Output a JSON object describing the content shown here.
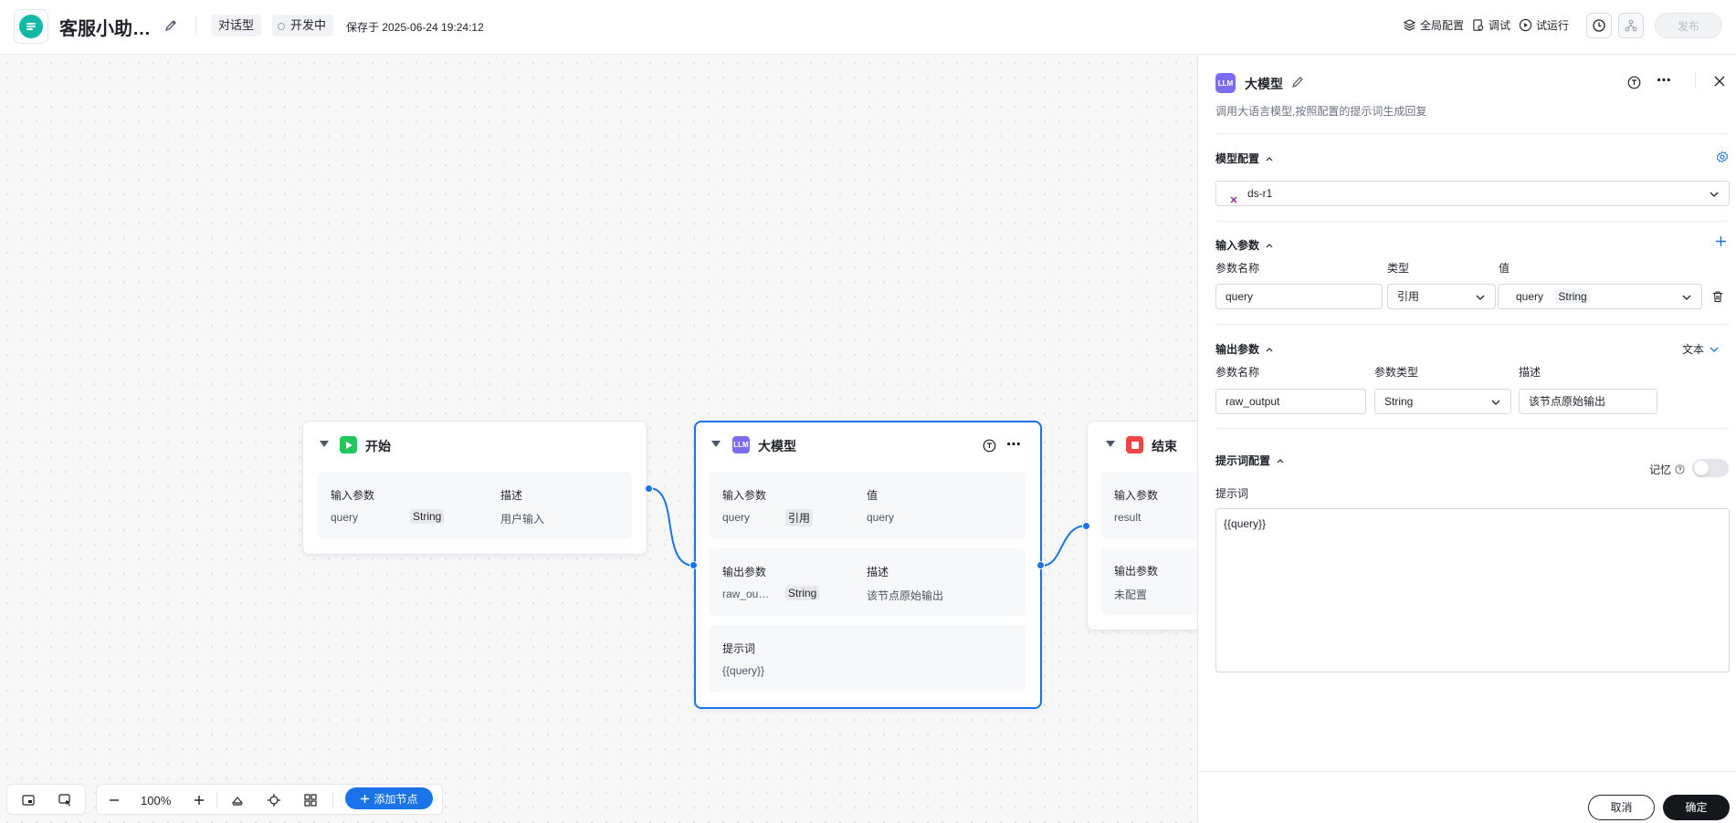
{
  "header": {
    "app_title": "客服小助…",
    "type_tag": "对话型",
    "status_tag": "开发中",
    "saved_text": "保存于 2025-06-24 19:24:12",
    "actions": {
      "global_config": "全局配置",
      "debug": "调试",
      "trial_run": "试运行",
      "publish": "发布"
    }
  },
  "canvas": {
    "zoom": "100%",
    "add_node_label": "添加节点",
    "nodes": {
      "start": {
        "title": "开始",
        "col1": "输入参数",
        "col2": "描述",
        "param_name": "query",
        "param_type": "String",
        "param_desc": "用户输入"
      },
      "llm": {
        "badge": "LLM",
        "title": "大模型",
        "input_col1": "输入参数",
        "input_col2": "值",
        "input_name": "query",
        "input_type": "引用",
        "input_value": "query",
        "output_col1": "输出参数",
        "output_col2": "描述",
        "output_name": "raw_ou…",
        "output_type": "String",
        "output_desc": "该节点原始输出",
        "prompt_label": "提示词",
        "prompt_value": "{{query}}"
      },
      "end": {
        "title": "结束",
        "input_col": "输入参数",
        "input_name": "result",
        "output_col": "输出参数",
        "output_value": "未配置"
      }
    }
  },
  "panel": {
    "badge": "LLM",
    "title": "大模型",
    "description": "调用大语言模型,按照配置的提示词生成回复",
    "model_section": {
      "title": "模型配置",
      "selected_model": "ds-r1"
    },
    "input_section": {
      "title": "输入参数",
      "col_name": "参数名称",
      "col_type": "类型",
      "col_value": "值",
      "row": {
        "name": "query",
        "type": "引用",
        "value_name": "query",
        "value_type": "String"
      }
    },
    "output_section": {
      "title": "输出参数",
      "format": "文本",
      "col_name": "参数名称",
      "col_type": "参数类型",
      "col_desc": "描述",
      "row": {
        "name": "raw_output",
        "type": "String",
        "desc": "该节点原始输出"
      }
    },
    "prompt_section": {
      "title": "提示词配置",
      "memory_label": "记忆",
      "prompt_label": "提示词",
      "prompt_value": "{{query}}",
      "memory_enabled": false
    },
    "footer": {
      "cancel": "取消",
      "ok": "确定"
    }
  },
  "colors": {
    "accent": "#1a73e8",
    "start_node": "#22c55e",
    "llm_node": "#7c6cf0",
    "end_node": "#ef4444",
    "logo": "#14b8a6"
  }
}
